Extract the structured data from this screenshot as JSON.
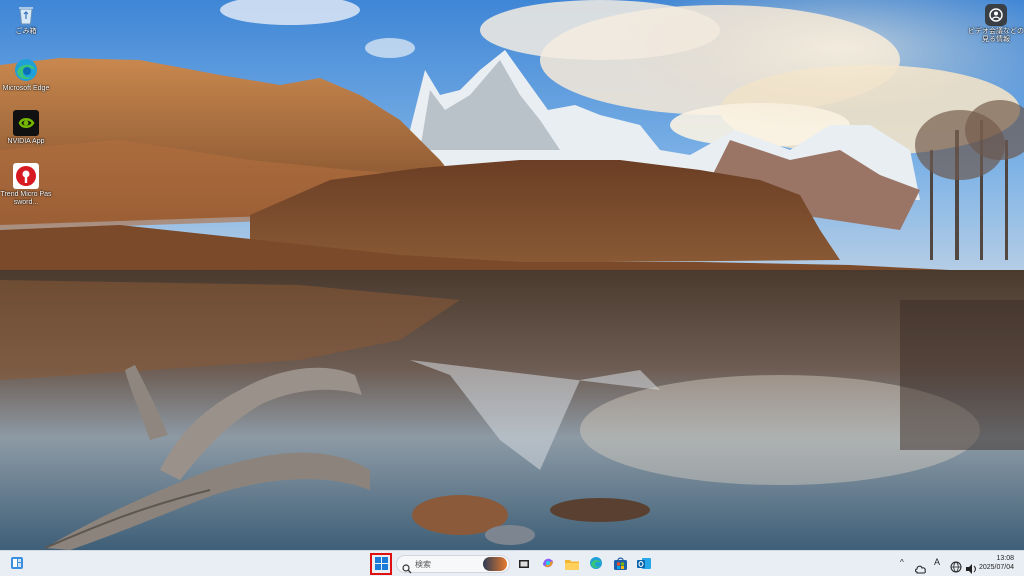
{
  "desktop": {
    "icons": [
      {
        "label": "ごみ箱",
        "icon": "recycle-bin-icon"
      },
      {
        "label": "Microsoft Edge",
        "icon": "edge-icon"
      },
      {
        "label": "NVIDIA App",
        "icon": "nvidia-icon"
      },
      {
        "label": "Trend Micro Password...",
        "icon": "trend-micro-password-icon"
      }
    ],
    "corner_widget": {
      "label": "ビデオ会議などの 見る情報",
      "icon": "spotlight-icon"
    }
  },
  "taskbar": {
    "widgets_icon": "widgets-icon",
    "start_icon": "windows-start-icon",
    "search_placeholder": "検索",
    "pinned": [
      {
        "name": "task-view",
        "icon": "task-view-icon"
      },
      {
        "name": "copilot",
        "icon": "copilot-icon"
      },
      {
        "name": "file-explorer",
        "icon": "folder-icon"
      },
      {
        "name": "edge",
        "icon": "edge-icon"
      },
      {
        "name": "microsoft-store",
        "icon": "store-icon"
      },
      {
        "name": "outlook",
        "icon": "outlook-icon"
      }
    ],
    "tray": {
      "chevron": "^",
      "ime": "A",
      "time": "13:08",
      "date": "2025/07/04"
    },
    "colors": {
      "start_highlight": "#e01010",
      "background": "#e9eef5"
    }
  }
}
